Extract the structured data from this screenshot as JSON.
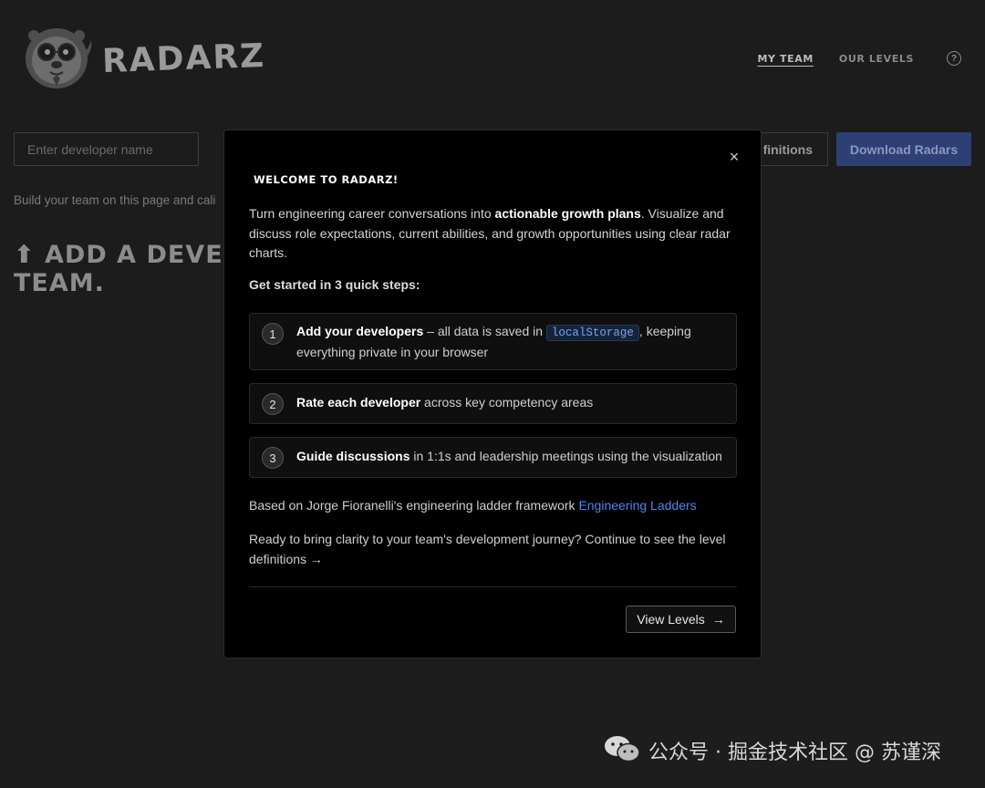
{
  "header": {
    "brand": "RADARZ",
    "nav": {
      "my_team": "MY TEAM",
      "our_levels": "OUR LEVELS",
      "help": "?"
    }
  },
  "toolbar": {
    "developer_placeholder": "Enter developer name",
    "definitions_button": "finitions",
    "download_button": "Download Radars",
    "accent_color": "#2e3f73"
  },
  "main": {
    "helper_text": "Build your team on this page and cali",
    "empty_heading_line1": "⬆ ADD A DEVEL",
    "empty_heading_line2": "TEAM."
  },
  "modal": {
    "close_glyph": "×",
    "title": "WELCOME TO RADARZ!",
    "intro_before": "Turn engineering career conversations into ",
    "intro_bold": "actionable growth plans",
    "intro_after": ". Visualize and discuss role expectations, current abilities, and growth opportunities using clear radar charts.",
    "steps_heading": "Get started in 3 quick steps:",
    "steps": [
      {
        "num": "1",
        "bold": "Add your developers",
        "text_before": " – all data is saved in ",
        "code": "localStorage",
        "text_after": ", keeping everything private in your browser"
      },
      {
        "num": "2",
        "bold": "Rate each developer",
        "text_before": " across key competency areas"
      },
      {
        "num": "3",
        "bold": "Guide discussions",
        "text_before": " in 1:1s and leadership meetings using the visualization"
      }
    ],
    "attribution_text": "Based on Jorge Fioranelli's engineering ladder framework ",
    "attribution_link": "Engineering Ladders",
    "link_color": "#4a86f0",
    "ready_text": "Ready to bring clarity to your team's development journey? Continue to see the level definitions →",
    "view_levels_button": "View Levels",
    "view_levels_arrow": "→"
  },
  "watermark": {
    "text": "公众号 · 掘金技术社区 @ 苏谨深"
  }
}
